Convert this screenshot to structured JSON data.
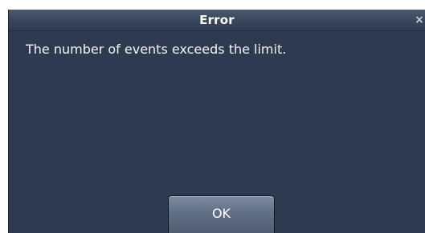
{
  "dialog": {
    "title": "Error",
    "close_icon": "close-icon",
    "close_glyph": "×",
    "message": "The number of events exceeds the limit.",
    "ok_label": "OK"
  }
}
